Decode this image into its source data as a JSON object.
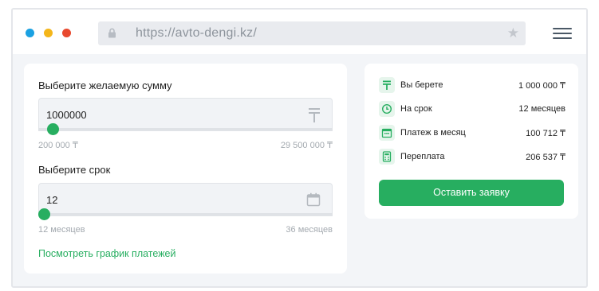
{
  "browser": {
    "url": "https://avto-dengi.kz/",
    "icons": {
      "lock": "lock-icon",
      "star": "star-icon",
      "menu": "hamburger-menu-icon"
    },
    "window_dots": [
      "#1ba1e2",
      "#f4b61a",
      "#e8492f"
    ]
  },
  "calculator": {
    "amount": {
      "label": "Выберите желаемую сумму",
      "value": "1000000",
      "currency_icon": "tenge-icon",
      "min_label": "200 000 ₸",
      "max_label": "29 500 000 ₸",
      "slider_value_fraction": 0.03
    },
    "term": {
      "label": "Выберите срок",
      "value": "12",
      "calendar_icon": "calendar-icon",
      "min_label": "12 месяцев",
      "max_label": "36 месяцев",
      "slider_value_fraction": 0.0
    },
    "schedule_link": "Посмотреть график платежей"
  },
  "summary": {
    "rows": [
      {
        "icon": "tenge-icon",
        "label": "Вы берете",
        "value": "1 000 000 ₸"
      },
      {
        "icon": "clock-icon",
        "label": "На срок",
        "value": "12 месяцев"
      },
      {
        "icon": "calendar-icon",
        "label": "Платеж в месяц",
        "value": "100 712 ₸"
      },
      {
        "icon": "calculator-icon",
        "label": "Переплата",
        "value": "206 537 ₸"
      }
    ],
    "submit_label": "Оставить заявку"
  },
  "colors": {
    "accent": "#27ae60",
    "accent_light": "#e6f5ec",
    "muted_text": "#a4aab0",
    "background": "#f3f5f8"
  }
}
